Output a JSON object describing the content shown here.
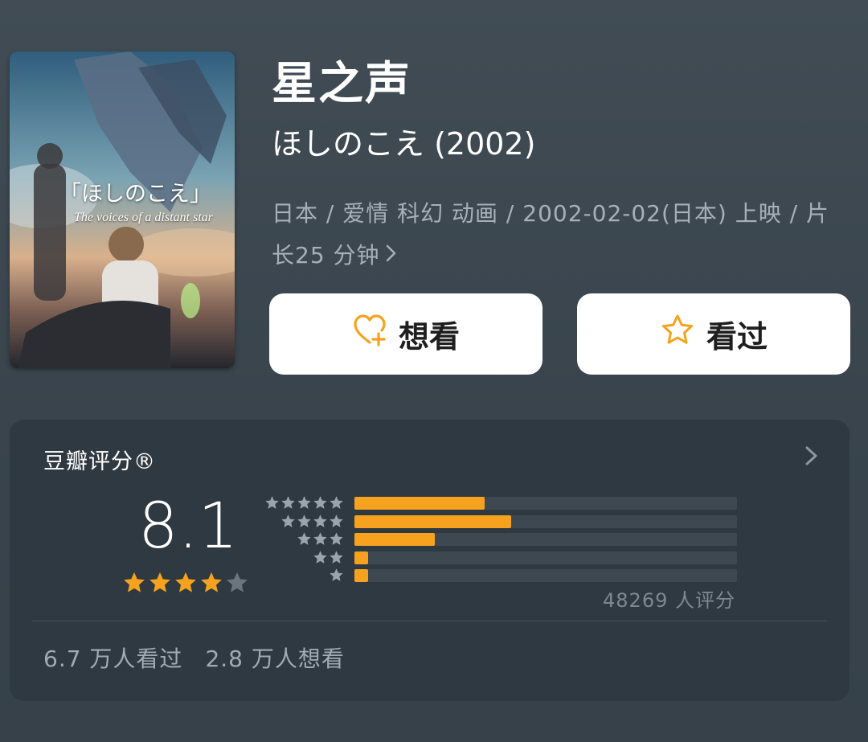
{
  "poster": {
    "title_text": "「ほしのこえ」",
    "subtitle_text": "The voices of a distant star"
  },
  "movie": {
    "title": "星之声",
    "original_title": "ほしのこえ (2002)",
    "meta": "日本 / 爱情 科幻 动画 / 2002-02-02(日本) 上映 / 片长25 分钟"
  },
  "actions": {
    "want_label": "想看",
    "seen_label": "看过",
    "accent_color": "#f6a21e"
  },
  "rating": {
    "header": "豆瓣评分®",
    "score": "8.1",
    "stars_filled": 4,
    "stars_total": 5,
    "count_text": "48269 人评分",
    "distribution": [
      {
        "stars": 5,
        "fraction": 0.34
      },
      {
        "stars": 4,
        "fraction": 0.41
      },
      {
        "stars": 3,
        "fraction": 0.21
      },
      {
        "stars": 2,
        "fraction": 0.035
      },
      {
        "stars": 1,
        "fraction": 0.035
      }
    ],
    "seen_text": "6.7 万人看过",
    "want_text": "2.8 万人想看"
  }
}
